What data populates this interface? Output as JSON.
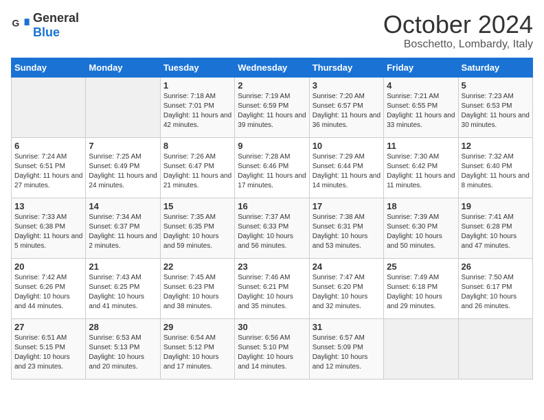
{
  "header": {
    "logo_general": "General",
    "logo_blue": "Blue",
    "month": "October 2024",
    "location": "Boschetto, Lombardy, Italy"
  },
  "weekdays": [
    "Sunday",
    "Monday",
    "Tuesday",
    "Wednesday",
    "Thursday",
    "Friday",
    "Saturday"
  ],
  "weeks": [
    [
      {
        "day": "",
        "sunrise": "",
        "sunset": "",
        "daylight": ""
      },
      {
        "day": "",
        "sunrise": "",
        "sunset": "",
        "daylight": ""
      },
      {
        "day": "1",
        "sunrise": "Sunrise: 7:18 AM",
        "sunset": "Sunset: 7:01 PM",
        "daylight": "Daylight: 11 hours and 42 minutes."
      },
      {
        "day": "2",
        "sunrise": "Sunrise: 7:19 AM",
        "sunset": "Sunset: 6:59 PM",
        "daylight": "Daylight: 11 hours and 39 minutes."
      },
      {
        "day": "3",
        "sunrise": "Sunrise: 7:20 AM",
        "sunset": "Sunset: 6:57 PM",
        "daylight": "Daylight: 11 hours and 36 minutes."
      },
      {
        "day": "4",
        "sunrise": "Sunrise: 7:21 AM",
        "sunset": "Sunset: 6:55 PM",
        "daylight": "Daylight: 11 hours and 33 minutes."
      },
      {
        "day": "5",
        "sunrise": "Sunrise: 7:23 AM",
        "sunset": "Sunset: 6:53 PM",
        "daylight": "Daylight: 11 hours and 30 minutes."
      }
    ],
    [
      {
        "day": "6",
        "sunrise": "Sunrise: 7:24 AM",
        "sunset": "Sunset: 6:51 PM",
        "daylight": "Daylight: 11 hours and 27 minutes."
      },
      {
        "day": "7",
        "sunrise": "Sunrise: 7:25 AM",
        "sunset": "Sunset: 6:49 PM",
        "daylight": "Daylight: 11 hours and 24 minutes."
      },
      {
        "day": "8",
        "sunrise": "Sunrise: 7:26 AM",
        "sunset": "Sunset: 6:47 PM",
        "daylight": "Daylight: 11 hours and 21 minutes."
      },
      {
        "day": "9",
        "sunrise": "Sunrise: 7:28 AM",
        "sunset": "Sunset: 6:46 PM",
        "daylight": "Daylight: 11 hours and 17 minutes."
      },
      {
        "day": "10",
        "sunrise": "Sunrise: 7:29 AM",
        "sunset": "Sunset: 6:44 PM",
        "daylight": "Daylight: 11 hours and 14 minutes."
      },
      {
        "day": "11",
        "sunrise": "Sunrise: 7:30 AM",
        "sunset": "Sunset: 6:42 PM",
        "daylight": "Daylight: 11 hours and 11 minutes."
      },
      {
        "day": "12",
        "sunrise": "Sunrise: 7:32 AM",
        "sunset": "Sunset: 6:40 PM",
        "daylight": "Daylight: 11 hours and 8 minutes."
      }
    ],
    [
      {
        "day": "13",
        "sunrise": "Sunrise: 7:33 AM",
        "sunset": "Sunset: 6:38 PM",
        "daylight": "Daylight: 11 hours and 5 minutes."
      },
      {
        "day": "14",
        "sunrise": "Sunrise: 7:34 AM",
        "sunset": "Sunset: 6:37 PM",
        "daylight": "Daylight: 11 hours and 2 minutes."
      },
      {
        "day": "15",
        "sunrise": "Sunrise: 7:35 AM",
        "sunset": "Sunset: 6:35 PM",
        "daylight": "Daylight: 10 hours and 59 minutes."
      },
      {
        "day": "16",
        "sunrise": "Sunrise: 7:37 AM",
        "sunset": "Sunset: 6:33 PM",
        "daylight": "Daylight: 10 hours and 56 minutes."
      },
      {
        "day": "17",
        "sunrise": "Sunrise: 7:38 AM",
        "sunset": "Sunset: 6:31 PM",
        "daylight": "Daylight: 10 hours and 53 minutes."
      },
      {
        "day": "18",
        "sunrise": "Sunrise: 7:39 AM",
        "sunset": "Sunset: 6:30 PM",
        "daylight": "Daylight: 10 hours and 50 minutes."
      },
      {
        "day": "19",
        "sunrise": "Sunrise: 7:41 AM",
        "sunset": "Sunset: 6:28 PM",
        "daylight": "Daylight: 10 hours and 47 minutes."
      }
    ],
    [
      {
        "day": "20",
        "sunrise": "Sunrise: 7:42 AM",
        "sunset": "Sunset: 6:26 PM",
        "daylight": "Daylight: 10 hours and 44 minutes."
      },
      {
        "day": "21",
        "sunrise": "Sunrise: 7:43 AM",
        "sunset": "Sunset: 6:25 PM",
        "daylight": "Daylight: 10 hours and 41 minutes."
      },
      {
        "day": "22",
        "sunrise": "Sunrise: 7:45 AM",
        "sunset": "Sunset: 6:23 PM",
        "daylight": "Daylight: 10 hours and 38 minutes."
      },
      {
        "day": "23",
        "sunrise": "Sunrise: 7:46 AM",
        "sunset": "Sunset: 6:21 PM",
        "daylight": "Daylight: 10 hours and 35 minutes."
      },
      {
        "day": "24",
        "sunrise": "Sunrise: 7:47 AM",
        "sunset": "Sunset: 6:20 PM",
        "daylight": "Daylight: 10 hours and 32 minutes."
      },
      {
        "day": "25",
        "sunrise": "Sunrise: 7:49 AM",
        "sunset": "Sunset: 6:18 PM",
        "daylight": "Daylight: 10 hours and 29 minutes."
      },
      {
        "day": "26",
        "sunrise": "Sunrise: 7:50 AM",
        "sunset": "Sunset: 6:17 PM",
        "daylight": "Daylight: 10 hours and 26 minutes."
      }
    ],
    [
      {
        "day": "27",
        "sunrise": "Sunrise: 6:51 AM",
        "sunset": "Sunset: 5:15 PM",
        "daylight": "Daylight: 10 hours and 23 minutes."
      },
      {
        "day": "28",
        "sunrise": "Sunrise: 6:53 AM",
        "sunset": "Sunset: 5:13 PM",
        "daylight": "Daylight: 10 hours and 20 minutes."
      },
      {
        "day": "29",
        "sunrise": "Sunrise: 6:54 AM",
        "sunset": "Sunset: 5:12 PM",
        "daylight": "Daylight: 10 hours and 17 minutes."
      },
      {
        "day": "30",
        "sunrise": "Sunrise: 6:56 AM",
        "sunset": "Sunset: 5:10 PM",
        "daylight": "Daylight: 10 hours and 14 minutes."
      },
      {
        "day": "31",
        "sunrise": "Sunrise: 6:57 AM",
        "sunset": "Sunset: 5:09 PM",
        "daylight": "Daylight: 10 hours and 12 minutes."
      },
      {
        "day": "",
        "sunrise": "",
        "sunset": "",
        "daylight": ""
      },
      {
        "day": "",
        "sunrise": "",
        "sunset": "",
        "daylight": ""
      }
    ]
  ]
}
